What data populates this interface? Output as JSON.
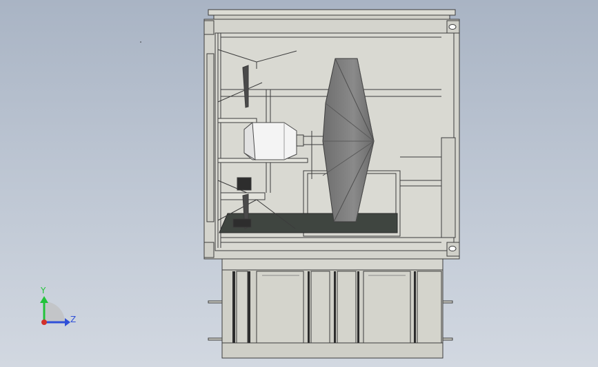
{
  "viewport": {
    "background_top": "#a9b4c4",
    "background_bottom": "#d2d8e1"
  },
  "model": {
    "shell_color": "#d6d6cf",
    "edge_color": "#3c3c3c",
    "dish_color": "#7a7a7a",
    "dish_dark": "#5a5a5a",
    "floor_color": "#3f4540",
    "feed_color": "#f4f4f4"
  },
  "triad": {
    "y_label": "Y",
    "z_label": "Z",
    "y_color": "#22c33a",
    "z_color": "#2f4fd8",
    "origin_color": "#d2302a"
  }
}
